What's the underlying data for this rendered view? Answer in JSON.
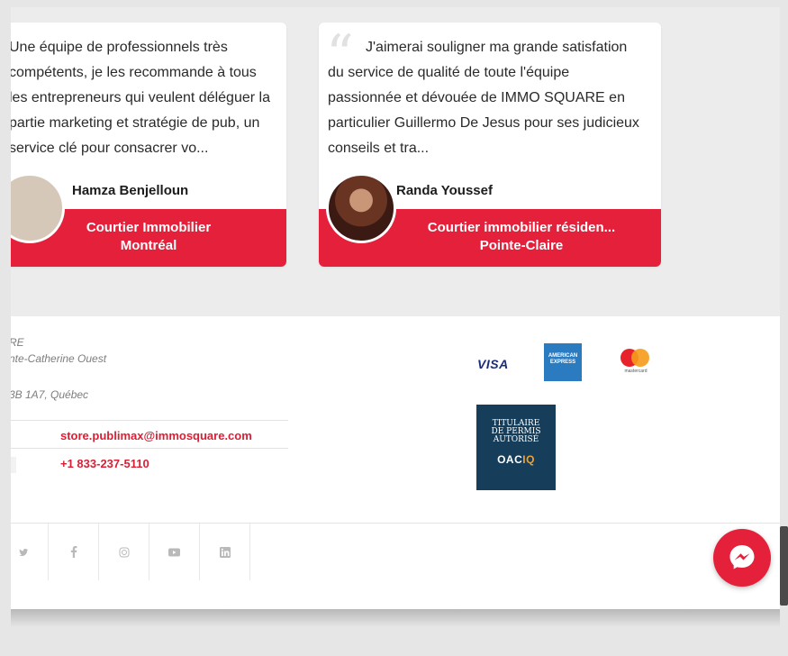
{
  "testimonials": [
    {
      "quote": "Une équipe de professionnels très compétents, je les recommande à tous les entrepreneurs qui veulent déléguer la partie marketing et stratégie de pub, un service clé pour consacrer vo...",
      "name": "Hamza Benjelloun",
      "role": "Courtier Immobilier",
      "city": "Montréal"
    },
    {
      "quote": "J'aimerai souligner ma grande satisfation du service de qualité de toute l'équipe passionnée et dévouée de IMMO SQUARE en particulier Guillermo De Jesus pour ses judicieux conseils et tra...",
      "name": "Randa Youssef",
      "role": "Courtier immobilier résiden...",
      "city": "Pointe-Claire"
    }
  ],
  "footer": {
    "address_line1": "RE",
    "address_line2": "nte-Catherine Ouest",
    "address_line3": "3B 1A7, Québec",
    "email": "store.publimax@immosquare.com",
    "phone": "+1 833-237-5110",
    "payments": {
      "visa": "VISA",
      "amex": "AMERICAN EXPRESS",
      "mastercard": "mastercard"
    },
    "oaciq": {
      "line1": "TITULAIRE",
      "line2": "DE PERMIS",
      "line3": "AUTORISÉ",
      "brand_a": "OAC",
      "brand_b": "IQ"
    },
    "social": [
      "twitter-icon",
      "facebook-icon",
      "instagram-icon",
      "youtube-icon",
      "linkedin-icon"
    ]
  },
  "colors": {
    "accent": "#e4203a",
    "oaciq": "#163e5a"
  }
}
